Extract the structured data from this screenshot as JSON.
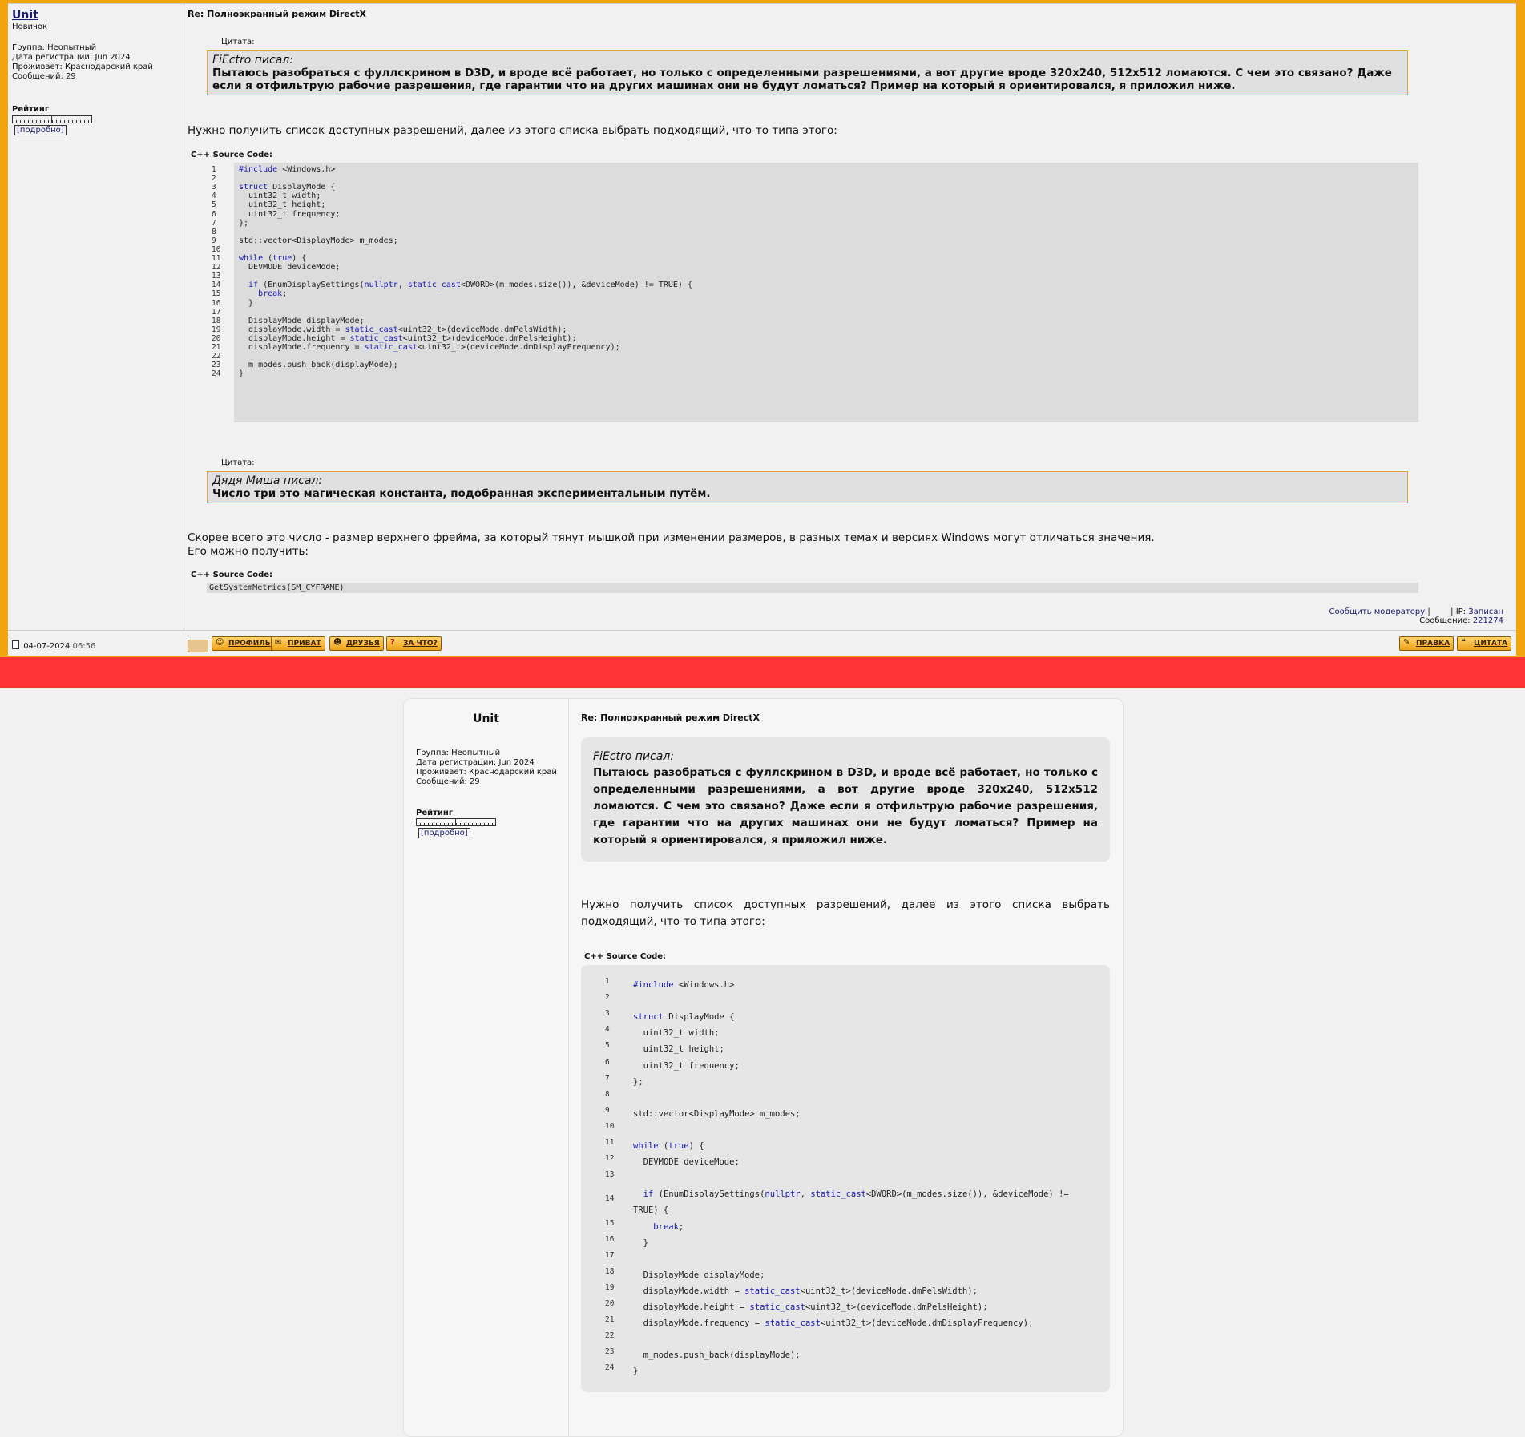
{
  "post": {
    "username": "Unit",
    "rank": "Новичок",
    "group": "Группа: Неопытный",
    "registered": "Дата регистрации: Jun 2024",
    "location": "Проживает: Краснодарский край",
    "messages": "Сообщений: 29",
    "rating_label": "Рейтинг",
    "rating_detail": "[подробно]",
    "subject": "Re: Полноэкранный режим DirectX",
    "quote1_label": "Цитата:",
    "quote1_author": "FiEctro писал:",
    "quote1_text": "Пытаюсь разобраться с фуллскрином в D3D, и вроде всё работает, но только с определенными разрешениями, а вот другие вроде 320х240, 512х512 ломаются. С чем это связано? Даже если я отфильтрую рабочие разрешения, где гарантии что на других машинах они не будут ломаться? Пример на который я ориентировался, я приложил ниже.",
    "para1": "Нужно получить список доступных разрешений, далее из этого списка выбрать подходящий, что-то типа этого:",
    "code_label": "C++ Source Code:",
    "code_lines": [
      "#include <Windows.h>",
      "",
      "struct DisplayMode {",
      "  uint32_t width;",
      "  uint32_t height;",
      "  uint32_t frequency;",
      "};",
      "",
      "std::vector<DisplayMode> m_modes;",
      "",
      "while (true) {",
      "  DEVMODE deviceMode;",
      "",
      "  if (EnumDisplaySettings(nullptr, static_cast<DWORD>(m_modes.size()), &deviceMode) != TRUE) {",
      "    break;",
      "  }",
      "",
      "  DisplayMode displayMode;",
      "  displayMode.width = static_cast<uint32_t>(deviceMode.dmPelsWidth);",
      "  displayMode.height = static_cast<uint32_t>(deviceMode.dmPelsHeight);",
      "  displayMode.frequency = static_cast<uint32_t>(deviceMode.dmDisplayFrequency);",
      "",
      "  m_modes.push_back(displayMode);",
      "}"
    ],
    "quote2_label": "Цитата:",
    "quote2_author": "Дядя Миша писал:",
    "quote2_text": "Число три это магическая константа, подобранная экспериментальным путём.",
    "para2_line1": "Скорее всего это число - размер верхнего фрейма, за который тянут мышкой при изменении размеров, в разных темах и версиях Windows могут отличаться значения.",
    "para2_line2": "Его можно получить:",
    "code2_label": "C++ Source Code:",
    "code2_line": "GetSystemMetrics(SM_CYFRAME)",
    "report_link": "Сообщить модератору",
    "ip_label": "| IP:",
    "ip_value": "Записан",
    "message_label": "Сообщение:",
    "message_id": "221274",
    "date": "04-07-2024",
    "time": "06:56",
    "buttons": {
      "profile": "ПРОФИЛЬ",
      "private": "ПРИВАТ",
      "friends": "ДРУЗЬЯ",
      "why": "ЗА ЧТО?",
      "edit": "ПРАВКА",
      "quote": "ЦИТАТА"
    }
  },
  "colors": {
    "frame": "#f2a50f",
    "separator": "#ff3535",
    "keyword": "#1717b0"
  }
}
